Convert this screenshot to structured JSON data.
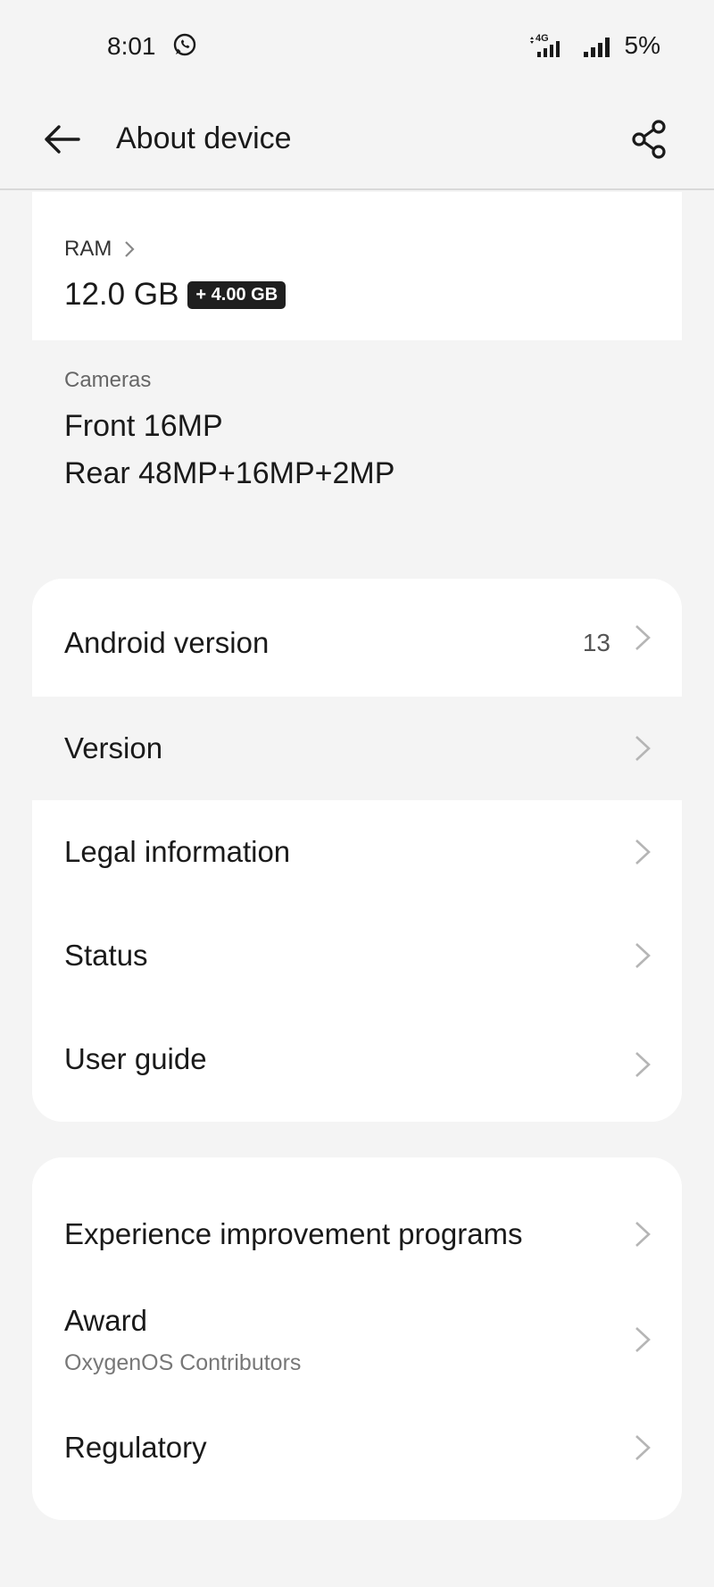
{
  "status": {
    "time": "8:01",
    "network": "4G",
    "battery": "5%"
  },
  "appbar": {
    "title": "About device"
  },
  "ram": {
    "label": "RAM",
    "value": "12.0 GB",
    "extended": "+ 4.00 GB"
  },
  "cameras": {
    "label": "Cameras",
    "front": "Front 16MP",
    "rear": "Rear 48MP+16MP+2MP"
  },
  "group1": {
    "items": [
      {
        "label": "Android version",
        "value": "13"
      },
      {
        "label": "Version"
      },
      {
        "label": "Legal information"
      },
      {
        "label": "Status"
      },
      {
        "label": "User guide"
      }
    ]
  },
  "group2": {
    "items": [
      {
        "label": "Experience improvement programs"
      },
      {
        "label": "Award",
        "sub": "OxygenOS Contributors"
      },
      {
        "label": "Regulatory"
      }
    ]
  },
  "icons": {
    "status": [
      "whatsapp-icon",
      "signal-4g-icon",
      "signal-icon"
    ],
    "appbar": [
      "back-arrow-icon",
      "share-icon"
    ],
    "rows": "chevron-right-icon"
  }
}
